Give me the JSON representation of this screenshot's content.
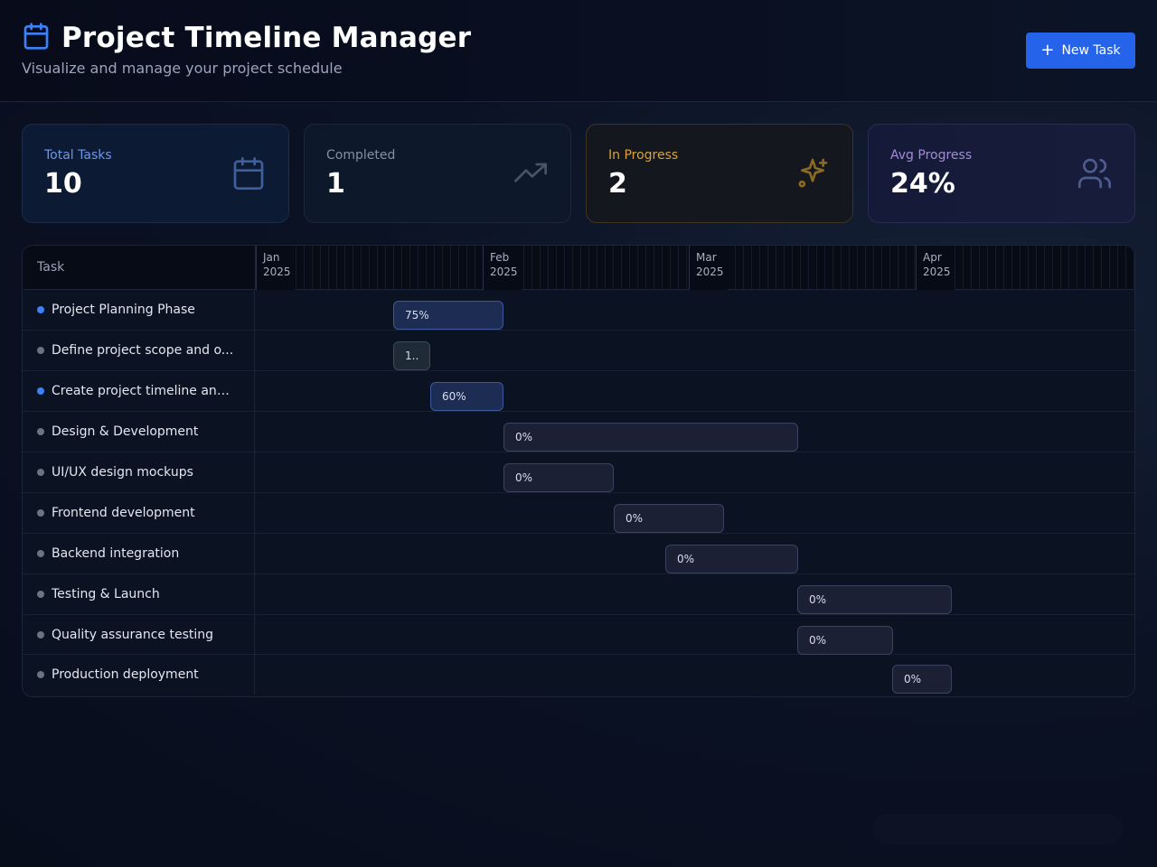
{
  "header": {
    "title": "Project Timeline Manager",
    "subtitle": "Visualize and manage your project schedule",
    "new_task_label": "New Task",
    "icon": "calendar-icon"
  },
  "stats": [
    {
      "label": "Total Tasks",
      "value": "10",
      "icon": "calendar-icon"
    },
    {
      "label": "Completed",
      "value": "1",
      "icon": "trending-up-icon"
    },
    {
      "label": "In Progress",
      "value": "2",
      "icon": "sparkles-icon"
    },
    {
      "label": "Avg Progress",
      "value": "24%",
      "icon": "users-icon"
    }
  ],
  "gantt": {
    "task_header": "Task",
    "months": [
      {
        "label": "Jan",
        "year": "2025"
      },
      {
        "label": "Feb",
        "year": "2025"
      },
      {
        "label": "Mar",
        "year": "2025"
      },
      {
        "label": "Apr",
        "year": "2025"
      }
    ],
    "tasks": [
      {
        "name": "Project Planning Phase",
        "dot": "blue",
        "progress": 75,
        "progress_label": "75%",
        "style": "active"
      },
      {
        "name": "Define project scope and o...",
        "dot": "gray",
        "progress": 100,
        "progress_label": "1..",
        "style": "teal"
      },
      {
        "name": "Create project timeline and...",
        "dot": "blue",
        "progress": 60,
        "progress_label": "60%",
        "style": "active"
      },
      {
        "name": "Design & Development",
        "dot": "gray",
        "progress": 0,
        "progress_label": "0%",
        "style": ""
      },
      {
        "name": "UI/UX design mockups",
        "dot": "gray",
        "progress": 0,
        "progress_label": "0%",
        "style": ""
      },
      {
        "name": "Frontend development",
        "dot": "gray",
        "progress": 0,
        "progress_label": "0%",
        "style": ""
      },
      {
        "name": "Backend integration",
        "dot": "gray",
        "progress": 0,
        "progress_label": "0%",
        "style": ""
      },
      {
        "name": "Testing & Launch",
        "dot": "gray",
        "progress": 0,
        "progress_label": "0%",
        "style": ""
      },
      {
        "name": "Quality assurance testing",
        "dot": "gray",
        "progress": 0,
        "progress_label": "0%",
        "style": ""
      },
      {
        "name": "Production deployment",
        "dot": "gray",
        "progress": 0,
        "progress_label": "0%",
        "style": ""
      }
    ]
  },
  "colors": {
    "accent": "#2563eb",
    "in_progress": "#d7a33a",
    "total": "#6f97e8",
    "avg": "#a58bd6"
  }
}
